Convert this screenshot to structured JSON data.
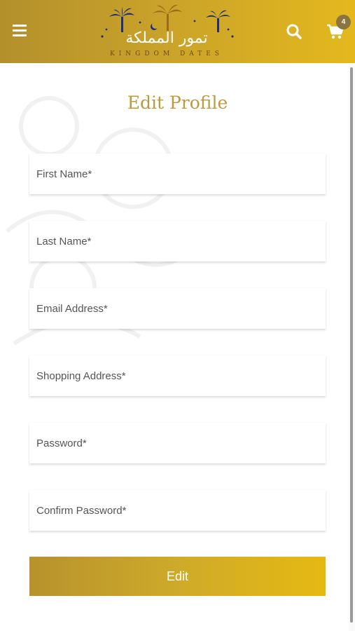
{
  "header": {
    "logo_arabic": "تمور المملكة",
    "logo_english": "KINGDOM DATES",
    "cart_count": "4"
  },
  "page": {
    "title": "Edit Profile"
  },
  "form": {
    "first_name": {
      "placeholder": "First Name*",
      "value": ""
    },
    "last_name": {
      "placeholder": "Last Name*",
      "value": ""
    },
    "email": {
      "placeholder": "Email Address*",
      "value": ""
    },
    "shopping_address": {
      "placeholder": "Shopping Address*",
      "value": ""
    },
    "password": {
      "placeholder": "Password*",
      "value": ""
    },
    "confirm_password": {
      "placeholder": "Confirm Password*",
      "value": ""
    },
    "submit_label": "Edit"
  },
  "theme": {
    "header_gradient": [
      "#b4902c",
      "#e4b81d"
    ],
    "title_color": "#bf9a3c",
    "button_gradient": [
      "#b7922c",
      "#e6b912"
    ],
    "logo_palm_colors": [
      "#1b2f7a",
      "#9c6a1e"
    ]
  },
  "icons": {
    "menu": "hamburger-icon",
    "search": "search-icon",
    "cart": "cart-icon"
  }
}
